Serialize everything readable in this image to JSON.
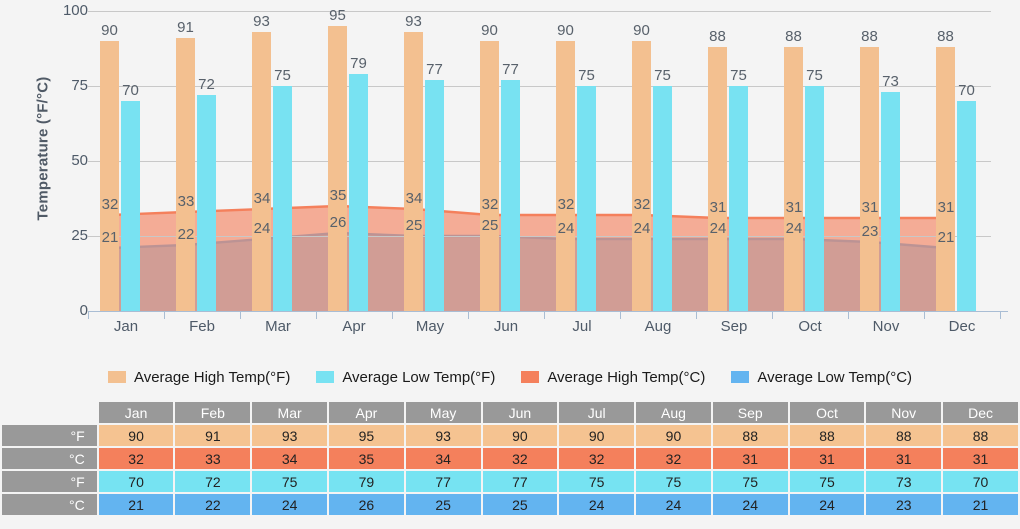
{
  "chart_data": {
    "type": "bar",
    "title": "",
    "xlabel": "",
    "ylabel": "Temperature (°F/°C)",
    "ylim": [
      0,
      100
    ],
    "yticks": [
      0,
      25,
      50,
      75,
      100
    ],
    "grid": true,
    "legend_position": "bottom",
    "categories": [
      "Jan",
      "Feb",
      "Mar",
      "Apr",
      "May",
      "Jun",
      "Jul",
      "Aug",
      "Sep",
      "Oct",
      "Nov",
      "Dec"
    ],
    "series": [
      {
        "name": "Average High Temp(°F)",
        "type": "bar",
        "color": "#f3c090",
        "values": [
          90,
          91,
          93,
          95,
          93,
          90,
          90,
          90,
          88,
          88,
          88,
          88
        ]
      },
      {
        "name": "Average Low Temp(°F)",
        "type": "bar",
        "color": "#78e2f2",
        "values": [
          70,
          72,
          75,
          79,
          77,
          77,
          75,
          75,
          75,
          75,
          73,
          70
        ]
      },
      {
        "name": "Average High Temp(°C)",
        "type": "area",
        "color": "#f4805c",
        "values": [
          32,
          33,
          34,
          35,
          34,
          32,
          32,
          32,
          31,
          31,
          31,
          31
        ]
      },
      {
        "name": "Average Low Temp(°C)",
        "type": "area",
        "color": "#63b4f0",
        "values": [
          21,
          22,
          24,
          26,
          25,
          25,
          24,
          24,
          24,
          24,
          23,
          21
        ]
      }
    ]
  },
  "axis": {
    "y_title": "Temperature (°F/°C)",
    "y_ticks": [
      "100",
      "75",
      "50",
      "25",
      "0"
    ],
    "x_labels": [
      "Jan",
      "Feb",
      "Mar",
      "Apr",
      "May",
      "Jun",
      "Jul",
      "Aug",
      "Sep",
      "Oct",
      "Nov",
      "Dec"
    ]
  },
  "legend": {
    "items": [
      {
        "label": "Average High Temp(°F)",
        "color": "#f3c090"
      },
      {
        "label": "Average Low Temp(°F)",
        "color": "#78e2f2"
      },
      {
        "label": "Average High Temp(°C)",
        "color": "#f4805c"
      },
      {
        "label": "Average Low Temp(°C)",
        "color": "#63b4f0"
      }
    ]
  },
  "table": {
    "corner_label": "",
    "month_headers": [
      "Jan",
      "Feb",
      "Mar",
      "Apr",
      "May",
      "Jun",
      "Jul",
      "Aug",
      "Sep",
      "Oct",
      "Nov",
      "Dec"
    ],
    "rows": [
      {
        "label": "°F",
        "style": "c-fhigh",
        "values": [
          90,
          91,
          93,
          95,
          93,
          90,
          90,
          90,
          88,
          88,
          88,
          88
        ]
      },
      {
        "label": "°C",
        "style": "c-chigh",
        "values": [
          32,
          33,
          34,
          35,
          34,
          32,
          32,
          32,
          31,
          31,
          31,
          31
        ]
      },
      {
        "label": "°F",
        "style": "c-flow",
        "values": [
          70,
          72,
          75,
          79,
          77,
          77,
          75,
          75,
          75,
          75,
          73,
          70
        ]
      },
      {
        "label": "°C",
        "style": "c-clow",
        "values": [
          21,
          22,
          24,
          26,
          25,
          25,
          24,
          24,
          24,
          24,
          23,
          21
        ]
      }
    ]
  },
  "colors": {
    "background": "#f4f4f4",
    "gridline": "#c8c8c8",
    "axis": "#a9bdd4",
    "table_header": "#999999",
    "label_text": "#58616b"
  }
}
